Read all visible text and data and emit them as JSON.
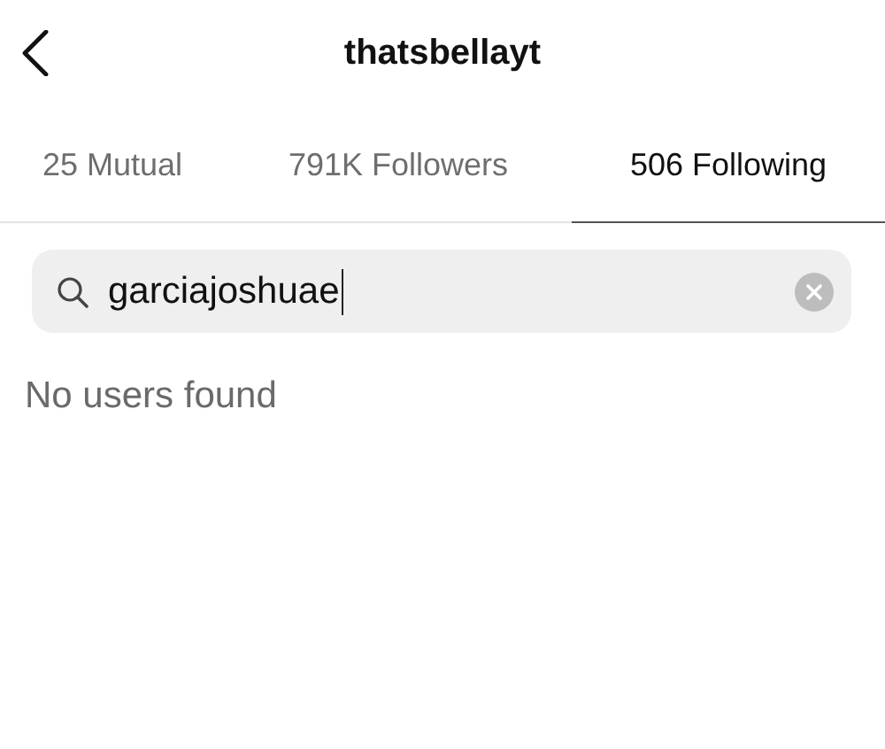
{
  "header": {
    "title": "thatsbellayt"
  },
  "tabs": [
    {
      "label": "25 Mutual",
      "selected": false
    },
    {
      "label": "791K Followers",
      "selected": false
    },
    {
      "label": "506 Following",
      "selected": true
    }
  ],
  "search": {
    "value": "garciajoshuae"
  },
  "message": "No users found"
}
